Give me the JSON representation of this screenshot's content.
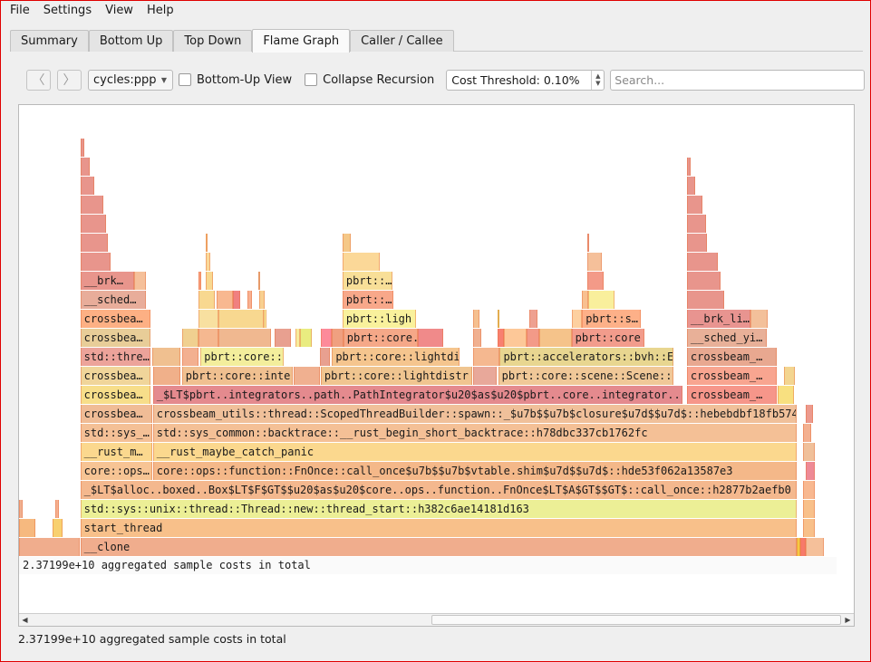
{
  "menu": [
    "File",
    "Settings",
    "View",
    "Help"
  ],
  "tabs": [
    {
      "label": "Summary"
    },
    {
      "label": "Bottom Up"
    },
    {
      "label": "Top Down"
    },
    {
      "label": "Flame Graph",
      "active": true
    },
    {
      "label": "Caller / Callee"
    }
  ],
  "toolbar": {
    "back_icon": "chevron-left-icon",
    "forward_icon": "chevron-right-icon",
    "event": "cycles:ppp",
    "bottom_up_label": "Bottom-Up View",
    "bottom_up_checked": false,
    "collapse_label": "Collapse Recursion",
    "collapse_checked": false,
    "threshold": "Cost Threshold: 0.10%",
    "search_placeholder": "Search..."
  },
  "graph": {
    "total_label": "2.37199e+10 aggregated sample costs in total",
    "frames_note_units": "start and width are percent of total cost; d is stack depth",
    "frames": [
      {
        "d": 0,
        "s": 0,
        "w": 7.5,
        "l": "",
        "c": "#f0ad8d"
      },
      {
        "d": 0,
        "s": 7.6,
        "w": 88.8,
        "l": "__clone",
        "c": "#f0ad8d"
      },
      {
        "d": 0,
        "s": 96.4,
        "w": 0.4,
        "l": "",
        "c": "#f5c842"
      },
      {
        "d": 0,
        "s": 96.9,
        "w": 0.6,
        "l": "",
        "c": "#f77a6a"
      },
      {
        "d": 0,
        "s": 97.5,
        "w": 2.3,
        "l": "",
        "c": "#f5c09a"
      },
      {
        "d": 1,
        "s": 0,
        "w": 2.0,
        "l": "",
        "c": "#f6b97f"
      },
      {
        "d": 1,
        "s": 4.2,
        "w": 1.2,
        "l": "",
        "c": "#f8d070"
      },
      {
        "d": 1,
        "s": 7.6,
        "w": 88.8,
        "l": "start_thread",
        "c": "#f8c08a"
      },
      {
        "d": 1,
        "s": 97.2,
        "w": 1.5,
        "l": "",
        "c": "#f8c08a"
      },
      {
        "d": 2,
        "s": 0,
        "w": 0.5,
        "l": "",
        "c": "#f0b090"
      },
      {
        "d": 2,
        "s": 4.5,
        "w": 0.4,
        "l": "",
        "c": "#f5b090"
      },
      {
        "d": 2,
        "s": 7.6,
        "w": 88.8,
        "l": "std::sys::unix::thread::Thread::new::thread_start::h382c6ae14181d163",
        "c": "#ecef96"
      },
      {
        "d": 2,
        "s": 97.2,
        "w": 1.5,
        "l": "",
        "c": "#f8c08a"
      },
      {
        "d": 3,
        "s": 7.6,
        "w": 88.8,
        "l": "_$LT$alloc..boxed..Box$LT$F$GT$$u20$as$u20$core..ops..function..FnOnce$LT$A$GT$$GT$::call_once::h2877b2aefb0",
        "c": "#f4b88e"
      },
      {
        "d": 3,
        "s": 97.2,
        "w": 1.5,
        "l": "",
        "c": "#f8b890"
      },
      {
        "d": 4,
        "s": 7.6,
        "w": 8.9,
        "l": "core::ops…",
        "c": "#f7c494"
      },
      {
        "d": 4,
        "s": 16.6,
        "w": 79.8,
        "l": "core::ops::function::FnOnce::call_once$u7b$$u7b$vtable.shim$u7d$$u7d$::hde53f062a13587e3",
        "c": "#f4b889"
      },
      {
        "d": 4,
        "s": 97.5,
        "w": 1.2,
        "l": "",
        "c": "#ee8a96"
      },
      {
        "d": 5,
        "s": 7.6,
        "w": 8.9,
        "l": "__rust_m…",
        "c": "#fbd88e"
      },
      {
        "d": 5,
        "s": 16.6,
        "w": 79.8,
        "l": "__rust_maybe_catch_panic",
        "c": "#fbd88e"
      },
      {
        "d": 5,
        "s": 97.2,
        "w": 1.5,
        "l": "",
        "c": "#f0c09a"
      },
      {
        "d": 6,
        "s": 7.6,
        "w": 8.9,
        "l": "std::sys_…",
        "c": "#f4c096"
      },
      {
        "d": 6,
        "s": 16.6,
        "w": 79.8,
        "l": "std::sys_common::backtrace::__rust_begin_short_backtrace::h78dbc337cb1762fc",
        "c": "#f4c096"
      },
      {
        "d": 6,
        "s": 97.2,
        "w": 1.0,
        "l": "",
        "c": "#f3b090"
      },
      {
        "d": 7,
        "s": 7.6,
        "w": 8.9,
        "l": "crossbea…",
        "c": "#f0bc96"
      },
      {
        "d": 7,
        "s": 16.6,
        "w": 79.8,
        "l": "crossbeam_utils::thread::ScopedThreadBuilder::spawn::_$u7b$$u7b$closure$u7d$$u7d$::hebebdbf18fb574",
        "c": "#f0c09a"
      },
      {
        "d": 7,
        "s": 97.5,
        "w": 0.9,
        "l": "",
        "c": "#ec9a8e"
      },
      {
        "d": 8,
        "s": 7.6,
        "w": 8.7,
        "l": "crossbea…",
        "c": "#f7de8a"
      },
      {
        "d": 8,
        "s": 16.6,
        "w": 65.6,
        "l": "_$LT$pbrt..integrators..path..PathIntegrator$u20$as$u20$pbrt..core..integrator..",
        "c": "#e48a8e"
      },
      {
        "d": 8,
        "s": 82.8,
        "w": 11.1,
        "l": "crossbeam_…",
        "c": "#f6968a"
      },
      {
        "d": 8,
        "s": 94.1,
        "w": 2.0,
        "l": "",
        "c": "#f8e080"
      },
      {
        "d": 9,
        "s": 7.6,
        "w": 8.7,
        "l": "crossbea…",
        "c": "#f0d59a"
      },
      {
        "d": 9,
        "s": 16.6,
        "w": 3.4,
        "l": "",
        "c": "#f0b08a"
      },
      {
        "d": 9,
        "s": 20.2,
        "w": 13.7,
        "l": "pbrt::core::inte",
        "c": "#f0c090"
      },
      {
        "d": 9,
        "s": 34.0,
        "w": 3.3,
        "l": "",
        "c": "#f0b090"
      },
      {
        "d": 9,
        "s": 37.4,
        "w": 18.8,
        "l": "pbrt::core::lightdistr",
        "c": "#f0c590"
      },
      {
        "d": 9,
        "s": 56.3,
        "w": 2.9,
        "l": "",
        "c": "#e8a89a"
      },
      {
        "d": 9,
        "s": 59.4,
        "w": 21.7,
        "l": "pbrt::core::scene::Scene::",
        "c": "#f0c898"
      },
      {
        "d": 9,
        "s": 82.8,
        "w": 11.1,
        "l": "crossbeam_…",
        "c": "#f8a590"
      },
      {
        "d": 9,
        "s": 94.8,
        "w": 1.4,
        "l": "",
        "c": "#f3d590"
      },
      {
        "d": 10,
        "s": 7.6,
        "w": 8.7,
        "l": "std::thre…",
        "c": "#eca39a"
      },
      {
        "d": 10,
        "s": 16.5,
        "w": 3.5,
        "l": "",
        "c": "#f0c090"
      },
      {
        "d": 10,
        "s": 20.2,
        "w": 2.0,
        "l": "",
        "c": "#f3b090"
      },
      {
        "d": 10,
        "s": 22.5,
        "w": 10.3,
        "l": "pbrt::core::",
        "c": "#f3ee9c"
      },
      {
        "d": 10,
        "s": 37.3,
        "w": 1.2,
        "l": "",
        "c": "#e8a090"
      },
      {
        "d": 10,
        "s": 38.8,
        "w": 15.8,
        "l": "pbrt::core::lightdi",
        "c": "#f5c58e"
      },
      {
        "d": 10,
        "s": 56.3,
        "w": 3.2,
        "l": "",
        "c": "#f5b890"
      },
      {
        "d": 10,
        "s": 59.6,
        "w": 21.5,
        "l": "pbrt::accelerators::bvh::E",
        "c": "#e8d690"
      },
      {
        "d": 10,
        "s": 82.8,
        "w": 11.1,
        "l": "crossbeam_…",
        "c": "#e8a890"
      },
      {
        "d": 11,
        "s": 7.6,
        "w": 8.7,
        "l": "crossbea…",
        "c": "#e8cd98"
      },
      {
        "d": 11,
        "s": 20.2,
        "w": 2.0,
        "l": "",
        "c": "#f0d090"
      },
      {
        "d": 11,
        "s": 22.2,
        "w": 2.5,
        "l": "",
        "c": "#f5b890"
      },
      {
        "d": 11,
        "s": 24.7,
        "w": 6.5,
        "l": "",
        "c": "#f0b890"
      },
      {
        "d": 11,
        "s": 31.7,
        "w": 2.0,
        "l": "",
        "c": "#e8a090"
      },
      {
        "d": 11,
        "s": 34.3,
        "w": 0.5,
        "l": "",
        "c": "#f8ec9c"
      },
      {
        "d": 11,
        "s": 34.8,
        "w": 1.5,
        "l": "",
        "c": "#e9ec80"
      },
      {
        "d": 11,
        "s": 37.4,
        "w": 1.4,
        "l": "",
        "c": "#fd8a9a"
      },
      {
        "d": 11,
        "s": 38.8,
        "w": 1.4,
        "l": "",
        "c": "#f0a080"
      },
      {
        "d": 11,
        "s": 40.2,
        "w": 9.2,
        "l": "pbrt::core.",
        "c": "#f5a888"
      },
      {
        "d": 11,
        "s": 49.4,
        "w": 3.2,
        "l": "",
        "c": "#f08a8a"
      },
      {
        "d": 11,
        "s": 56.3,
        "w": 1.0,
        "l": "",
        "c": "#f0b090"
      },
      {
        "d": 11,
        "s": 59.3,
        "w": 0.8,
        "l": "",
        "c": "#f88070"
      },
      {
        "d": 11,
        "s": 60.1,
        "w": 2.8,
        "l": "",
        "c": "#fdc898"
      },
      {
        "d": 11,
        "s": 62.9,
        "w": 1.6,
        "l": "",
        "c": "#f39a88"
      },
      {
        "d": 11,
        "s": 64.5,
        "w": 4.0,
        "l": "",
        "c": "#f5c38a"
      },
      {
        "d": 11,
        "s": 68.5,
        "w": 9.0,
        "l": "pbrt::core",
        "c": "#f29c8c"
      },
      {
        "d": 11,
        "s": 82.8,
        "w": 9.9,
        "l": "__sched_yi…",
        "c": "#e8b098"
      },
      {
        "d": 12,
        "s": 7.6,
        "w": 8.7,
        "l": "crossbea…",
        "c": "#fdb084"
      },
      {
        "d": 12,
        "s": 22.2,
        "w": 2.5,
        "l": "",
        "c": "#f8e0a0"
      },
      {
        "d": 12,
        "s": 24.7,
        "w": 5.6,
        "l": "",
        "c": "#f8d890"
      },
      {
        "d": 12,
        "s": 30.3,
        "w": 0.4,
        "l": "",
        "c": "#f9ef9c"
      },
      {
        "d": 12,
        "s": 40.1,
        "w": 9.1,
        "l": "pbrt::ligh",
        "c": "#f9f19c"
      },
      {
        "d": 12,
        "s": 56.3,
        "w": 0.8,
        "l": "",
        "c": "#f5c090"
      },
      {
        "d": 12,
        "s": 59.3,
        "w": 0.2,
        "l": "",
        "c": "#e0e060"
      },
      {
        "d": 12,
        "s": 63.3,
        "w": 1.0,
        "l": "",
        "c": "#eea090"
      },
      {
        "d": 12,
        "s": 68.5,
        "w": 1.3,
        "l": "",
        "c": "#fdd0a0"
      },
      {
        "d": 12,
        "s": 69.8,
        "w": 7.3,
        "l": "pbrt::s…",
        "c": "#fdb088"
      },
      {
        "d": 12,
        "s": 82.8,
        "w": 7.9,
        "l": "__brk_li…",
        "c": "#e89490"
      },
      {
        "d": 12,
        "s": 90.7,
        "w": 2.1,
        "l": "",
        "c": "#f3c09a"
      },
      {
        "d": 13,
        "s": 7.6,
        "w": 8.1,
        "l": "__sched…",
        "c": "#e8ad9a"
      },
      {
        "d": 13,
        "s": 22.2,
        "w": 2.1,
        "l": "",
        "c": "#f8d890"
      },
      {
        "d": 13,
        "s": 24.5,
        "w": 2.0,
        "l": "",
        "c": "#f8b890"
      },
      {
        "d": 13,
        "s": 26.5,
        "w": 0.9,
        "l": "",
        "c": "#f08080"
      },
      {
        "d": 13,
        "s": 28.3,
        "w": 0.6,
        "l": "",
        "c": "#f8b090"
      },
      {
        "d": 13,
        "s": 29.8,
        "w": 0.6,
        "l": "",
        "c": "#f8d090"
      },
      {
        "d": 13,
        "s": 40.1,
        "w": 6.3,
        "l": "pbrt::…",
        "c": "#f8a88a"
      },
      {
        "d": 13,
        "s": 69.8,
        "w": 0.8,
        "l": "",
        "c": "#f8c090"
      },
      {
        "d": 13,
        "s": 70.6,
        "w": 3.2,
        "l": "",
        "c": "#f9ef9c"
      },
      {
        "d": 13,
        "s": 82.8,
        "w": 4.6,
        "l": "",
        "c": "#e8958c"
      },
      {
        "d": 14,
        "s": 7.6,
        "w": 6.7,
        "l": "__brk…",
        "c": "#e8958c"
      },
      {
        "d": 14,
        "s": 14.3,
        "w": 1.4,
        "l": "",
        "c": "#f5c09a"
      },
      {
        "d": 14,
        "s": 22.2,
        "w": 0.4,
        "l": "",
        "c": "#f8a080"
      },
      {
        "d": 14,
        "s": 23.1,
        "w": 0.9,
        "l": "",
        "c": "#f8d890"
      },
      {
        "d": 14,
        "s": 29.7,
        "w": 0.2,
        "l": "",
        "c": "#e8c090"
      },
      {
        "d": 14,
        "s": 40.1,
        "w": 6.2,
        "l": "pbrt::…",
        "c": "#f8df98"
      },
      {
        "d": 14,
        "s": 70.4,
        "w": 2.1,
        "l": "",
        "c": "#f39a88"
      },
      {
        "d": 14,
        "s": 82.8,
        "w": 4.2,
        "l": "",
        "c": "#e8958c"
      },
      {
        "d": 15,
        "s": 7.6,
        "w": 3.7,
        "l": "",
        "c": "#e8958c"
      },
      {
        "d": 15,
        "s": 23.1,
        "w": 0.6,
        "l": "",
        "c": "#fad898"
      },
      {
        "d": 15,
        "s": 40.1,
        "w": 4.6,
        "l": "",
        "c": "#fbd898"
      },
      {
        "d": 15,
        "s": 70.4,
        "w": 1.8,
        "l": "",
        "c": "#f5c09a"
      },
      {
        "d": 15,
        "s": 82.8,
        "w": 3.8,
        "l": "",
        "c": "#e8958c"
      },
      {
        "d": 16,
        "s": 7.6,
        "w": 3.4,
        "l": "",
        "c": "#e8958c"
      },
      {
        "d": 16,
        "s": 23.1,
        "w": 0.3,
        "l": "",
        "c": "#f5c880"
      },
      {
        "d": 16,
        "s": 40.1,
        "w": 1.0,
        "l": "",
        "c": "#f5c888"
      },
      {
        "d": 16,
        "s": 70.4,
        "w": 0.3,
        "l": "",
        "c": "#eca090"
      },
      {
        "d": 16,
        "s": 82.8,
        "w": 2.5,
        "l": "",
        "c": "#e8958c"
      },
      {
        "d": 17,
        "s": 7.6,
        "w": 3.2,
        "l": "",
        "c": "#e8958c"
      },
      {
        "d": 17,
        "s": 82.8,
        "w": 2.4,
        "l": "",
        "c": "#e8958c"
      },
      {
        "d": 18,
        "s": 7.6,
        "w": 2.8,
        "l": "",
        "c": "#e8958c"
      },
      {
        "d": 18,
        "s": 82.8,
        "w": 1.9,
        "l": "",
        "c": "#e8958c"
      },
      {
        "d": 19,
        "s": 7.6,
        "w": 1.7,
        "l": "",
        "c": "#e8958c"
      },
      {
        "d": 19,
        "s": 82.8,
        "w": 1.0,
        "l": "",
        "c": "#e8958c"
      },
      {
        "d": 20,
        "s": 7.6,
        "w": 1.2,
        "l": "",
        "c": "#e8958c"
      },
      {
        "d": 20,
        "s": 82.8,
        "w": 0.5,
        "l": "",
        "c": "#e8958c"
      },
      {
        "d": 21,
        "s": 7.6,
        "w": 0.5,
        "l": "",
        "c": "#e8958c"
      }
    ]
  },
  "status": "2.37199e+10 aggregated sample costs in total"
}
